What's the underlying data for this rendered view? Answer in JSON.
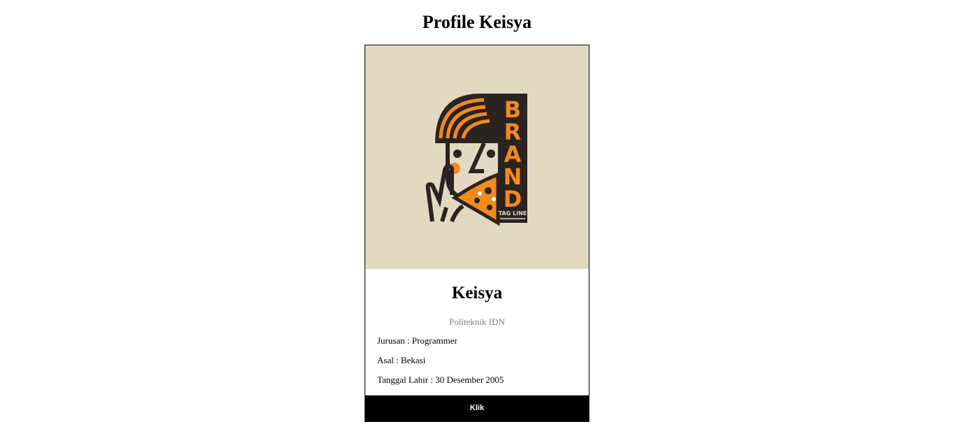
{
  "page": {
    "title": "Profile Keisya"
  },
  "profile": {
    "name": "Keisya",
    "school": "Politeknik IDN",
    "major_line": "Jurusan : Programmer",
    "origin_line": "Asal : Bekasi",
    "birth_line": "Tanggal Lahir : 30 Desember 2005",
    "button_label": "Klik"
  },
  "logo": {
    "brand_letters": [
      "B",
      "R",
      "A",
      "N",
      "D"
    ],
    "tagline": "TAG LINE",
    "colors": {
      "background": "#e3d9c3",
      "dark": "#2b2320",
      "orange": "#f28a1e"
    },
    "icon": "pizza-face-logo"
  },
  "theme": {
    "button_bg": "#000000",
    "button_text": "#ffffff",
    "subtitle_color": "#808080"
  }
}
